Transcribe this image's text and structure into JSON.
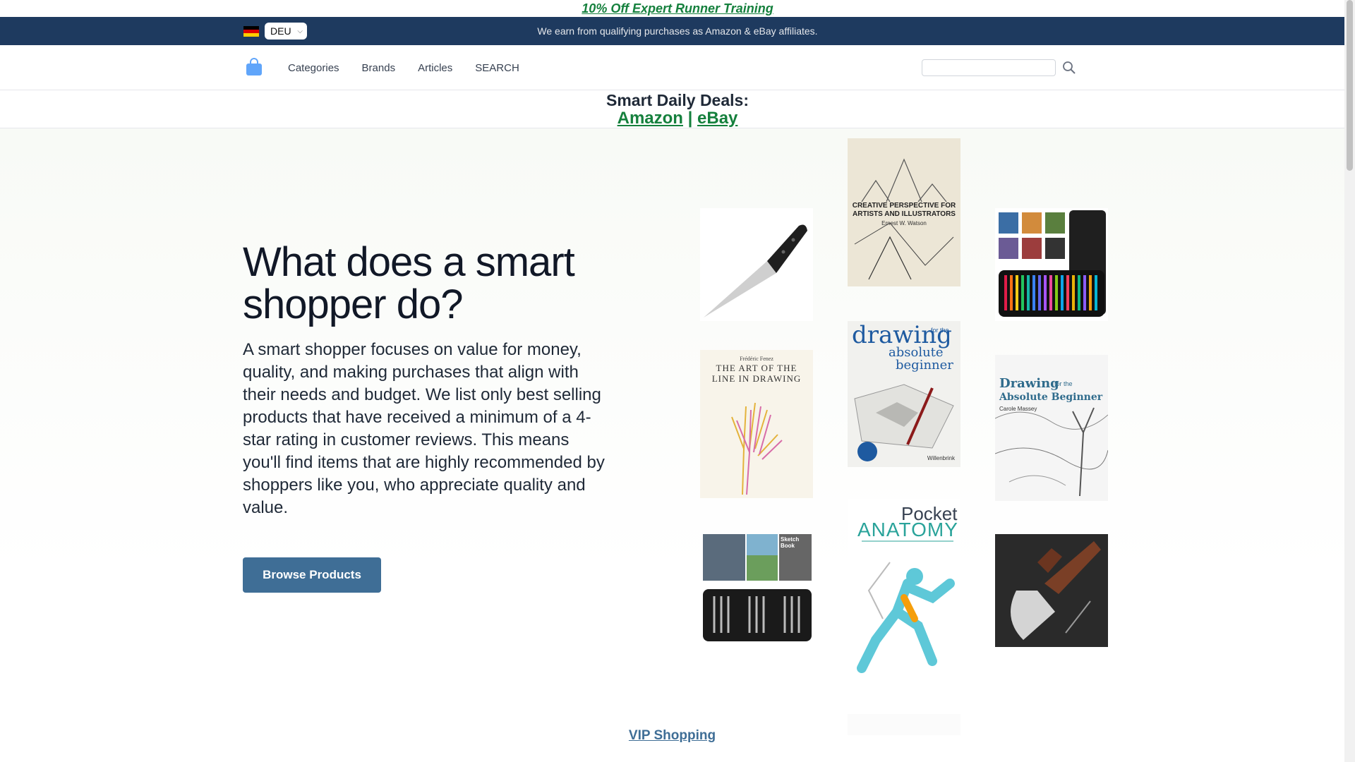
{
  "promo": {
    "text": "10% Off Expert Runner Training"
  },
  "affiliate_bar": {
    "language": "DEU",
    "note": "We earn from qualifying purchases as Amazon & eBay affiliates."
  },
  "nav": {
    "items": [
      "Categories",
      "Brands",
      "Articles",
      "SEARCH"
    ],
    "search_placeholder": ""
  },
  "deals": {
    "title": "Smart Daily Deals:",
    "amazon": "Amazon",
    "separator": "|",
    "ebay": "eBay"
  },
  "hero": {
    "headline": "What does a smart shopper do?",
    "description": "A smart shopper focuses on value for money, quality, and making purchases that align with their needs and budget. We list only best selling products that have received a minimum of a 4-star rating in customer reviews. This means you'll find items that are highly recommended by shoppers like you, who appreciate quality and value.",
    "cta": "Browse Products"
  },
  "products": [
    {
      "name": "knife",
      "lines": []
    },
    {
      "name": "book-creative-perspective",
      "lines": [
        "CREATIVE PERSPECTIVE FOR",
        "ARTISTS AND ILLUSTRATORS",
        "Ernest W. Watson"
      ]
    },
    {
      "name": "colored-pencil-set",
      "lines": []
    },
    {
      "name": "book-art-of-the-line",
      "lines": [
        "Frédéric Fenez",
        "THE ART OF THE",
        "LINE IN DRAWING"
      ]
    },
    {
      "name": "book-drawing-absolute-beginner-willenbrink",
      "lines": [
        "drawing",
        "for the",
        "absolute",
        "beginner",
        "Willenbrink"
      ]
    },
    {
      "name": "book-drawing-absolute-beginner-massey",
      "lines": [
        "Drawing",
        "for the",
        "Absolute Beginner",
        "Carole Massey"
      ]
    },
    {
      "name": "sketch-pencil-kit",
      "lines": [
        "Sketch Book"
      ]
    },
    {
      "name": "book-pocket-anatomy",
      "lines": [
        "Pocket",
        "ANATOMY"
      ]
    },
    {
      "name": "knife-axe-combo",
      "lines": []
    }
  ],
  "vip": {
    "label": "VIP Shopping"
  },
  "colors": {
    "promo": "#15803d",
    "bar": "#1e3a5f",
    "button": "#3f6e96"
  }
}
